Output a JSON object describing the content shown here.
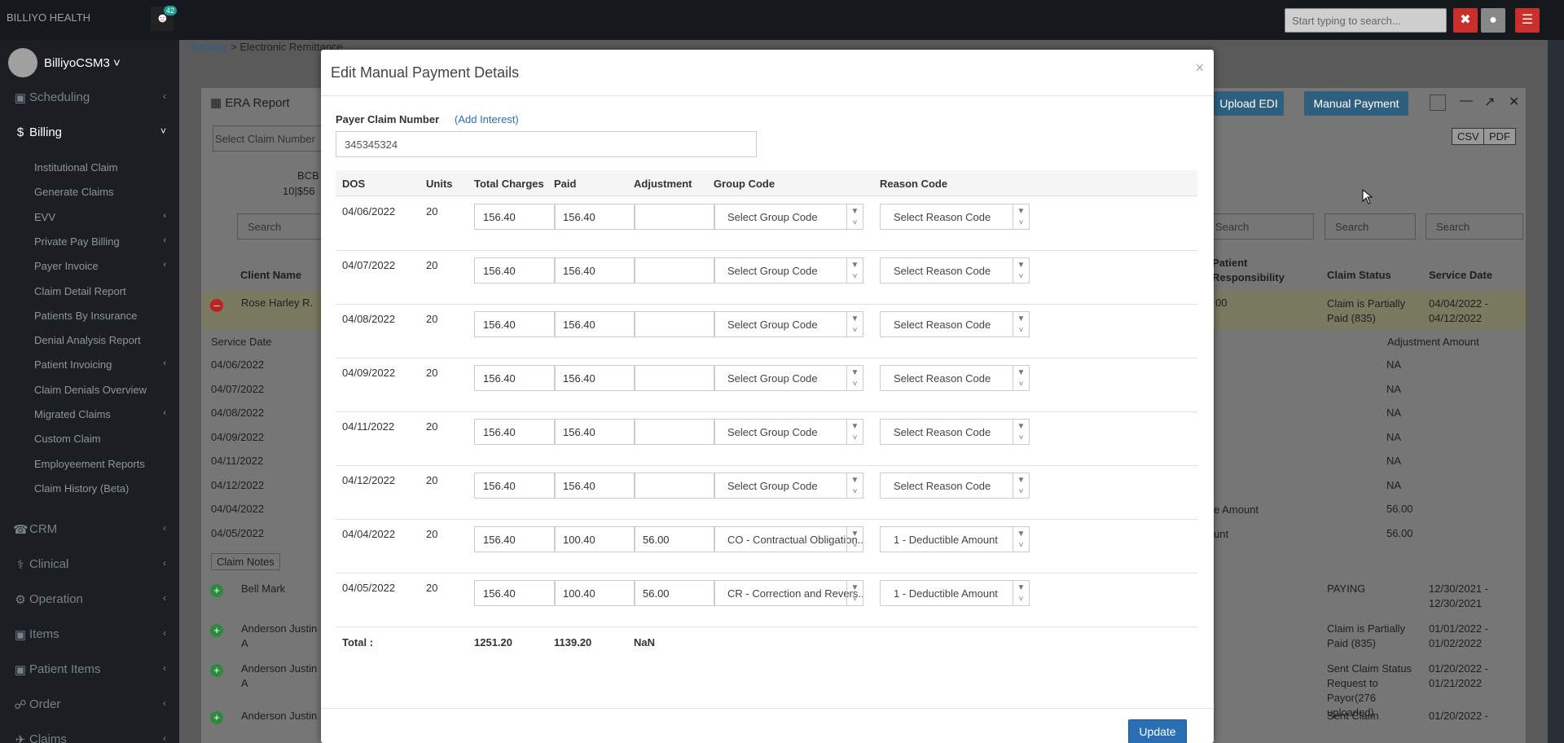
{
  "topbar": {
    "brand": "BILLIYO HEALTH",
    "notification_count": "42",
    "search_placeholder": "Start typing to search..."
  },
  "sidebar": {
    "user_name": "BilliyoCSM3",
    "sections": [
      {
        "label": "Scheduling",
        "icon": "calendar-plus-icon"
      },
      {
        "label": "Billing",
        "icon": "dollar-icon"
      }
    ],
    "billing_items": [
      "Institutional Claim",
      "Generate Claims",
      "EVV",
      "Private Pay Billing",
      "Payer Invoice",
      "Claim Detail Report",
      "Patients By Insurance",
      "Denial Analysis Report",
      "Patient Invoicing",
      "Claim Denials Overview",
      "Migrated Claims",
      "Custom Claim",
      "Employeement Reports",
      "Claim History (Beta)"
    ],
    "lower_sections": [
      "CRM",
      "Clinical",
      "Operation",
      "Items",
      "Patient Items",
      "Order",
      "Claims"
    ]
  },
  "background": {
    "breadcrumb_link": "Reports",
    "breadcrumb_rest": " > Electronic Remittance",
    "panel_title": "ERA Report",
    "upload_edi": "Upload EDI",
    "manual_payment": "Manual Payment",
    "csv": "CSV",
    "pdf": "PDF",
    "select_claim": "Select Claim Number",
    "bcb": "BCB",
    "bcb_sub": "10|$56",
    "search": "Search",
    "col_client": "Client Name",
    "col_patient_resp": "Patient\nResponsibility",
    "col_claim_status": "Claim Status",
    "col_service_date": "Service Date",
    "rows": [
      {
        "client": "Rose Harley R.",
        "status": "Claim is Partially Paid (835)",
        "date": "04/04/2022 - 04/12/2022"
      },
      {
        "client": "Bell Mark",
        "status": "PAYING",
        "date": "12/30/2021 - 12/30/2021"
      },
      {
        "client": "Anderson Justin A",
        "status": "Claim is Partially Paid (835)",
        "date": "01/01/2022 - 01/02/2022"
      },
      {
        "client": "Anderson Justin A",
        "status": "Sent Claim Status Request to Payor(276 uploaded)",
        "date": "01/20/2022 - 01/21/2022"
      },
      {
        "client": "Anderson Justin",
        "status": "Sent Claim",
        "date": "01/20/2022 -"
      }
    ],
    "sub_header_service": "Service Date",
    "sub_header_adjustment": "Adjustment Amount",
    "sub_dates": [
      "04/06/2022",
      "04/07/2022",
      "04/08/2022",
      "04/09/2022",
      "04/11/2022",
      "04/12/2022",
      "04/04/2022",
      "04/05/2022"
    ],
    "sub_adjust": [
      "NA",
      "NA",
      "NA",
      "NA",
      "NA",
      "NA",
      "56.00",
      "56.00"
    ],
    "claim_notes": "Claim Notes",
    "amount_label": "e Amount",
    "amount_label2": "unt",
    "resp_val": "00"
  },
  "modal": {
    "title": "Edit Manual Payment Details",
    "close": "×",
    "payer_claim_label": "Payer Claim Number",
    "add_interest": "(Add Interest)",
    "payer_claim_value": "345345324",
    "columns": {
      "dos": "DOS",
      "units": "Units",
      "total_charges": "Total Charges",
      "paid": "Paid",
      "adjustment": "Adjustment",
      "group_code": "Group Code",
      "reason_code": "Reason Code"
    },
    "rows": [
      {
        "dos": "04/06/2022",
        "units": "20",
        "charges": "156.40",
        "paid": "156.40",
        "adj": "",
        "group": "Select Group Code",
        "reason": "Select Reason Code"
      },
      {
        "dos": "04/07/2022",
        "units": "20",
        "charges": "156.40",
        "paid": "156.40",
        "adj": "",
        "group": "Select Group Code",
        "reason": "Select Reason Code"
      },
      {
        "dos": "04/08/2022",
        "units": "20",
        "charges": "156.40",
        "paid": "156.40",
        "adj": "",
        "group": "Select Group Code",
        "reason": "Select Reason Code"
      },
      {
        "dos": "04/09/2022",
        "units": "20",
        "charges": "156.40",
        "paid": "156.40",
        "adj": "",
        "group": "Select Group Code",
        "reason": "Select Reason Code"
      },
      {
        "dos": "04/11/2022",
        "units": "20",
        "charges": "156.40",
        "paid": "156.40",
        "adj": "",
        "group": "Select Group Code",
        "reason": "Select Reason Code"
      },
      {
        "dos": "04/12/2022",
        "units": "20",
        "charges": "156.40",
        "paid": "156.40",
        "adj": "",
        "group": "Select Group Code",
        "reason": "Select Reason Code"
      },
      {
        "dos": "04/04/2022",
        "units": "20",
        "charges": "156.40",
        "paid": "100.40",
        "adj": "56.00",
        "group": "CO - Contractual Obligation...",
        "reason": "1 - Deductible Amount"
      },
      {
        "dos": "04/05/2022",
        "units": "20",
        "charges": "156.40",
        "paid": "100.40",
        "adj": "56.00",
        "group": "CR - Correction and Revers...",
        "reason": "1 - Deductible Amount"
      }
    ],
    "total_label": "Total :",
    "total_charges": "1251.20",
    "total_paid": "1139.20",
    "total_adjustment": "NaN",
    "update_label": "Update"
  }
}
